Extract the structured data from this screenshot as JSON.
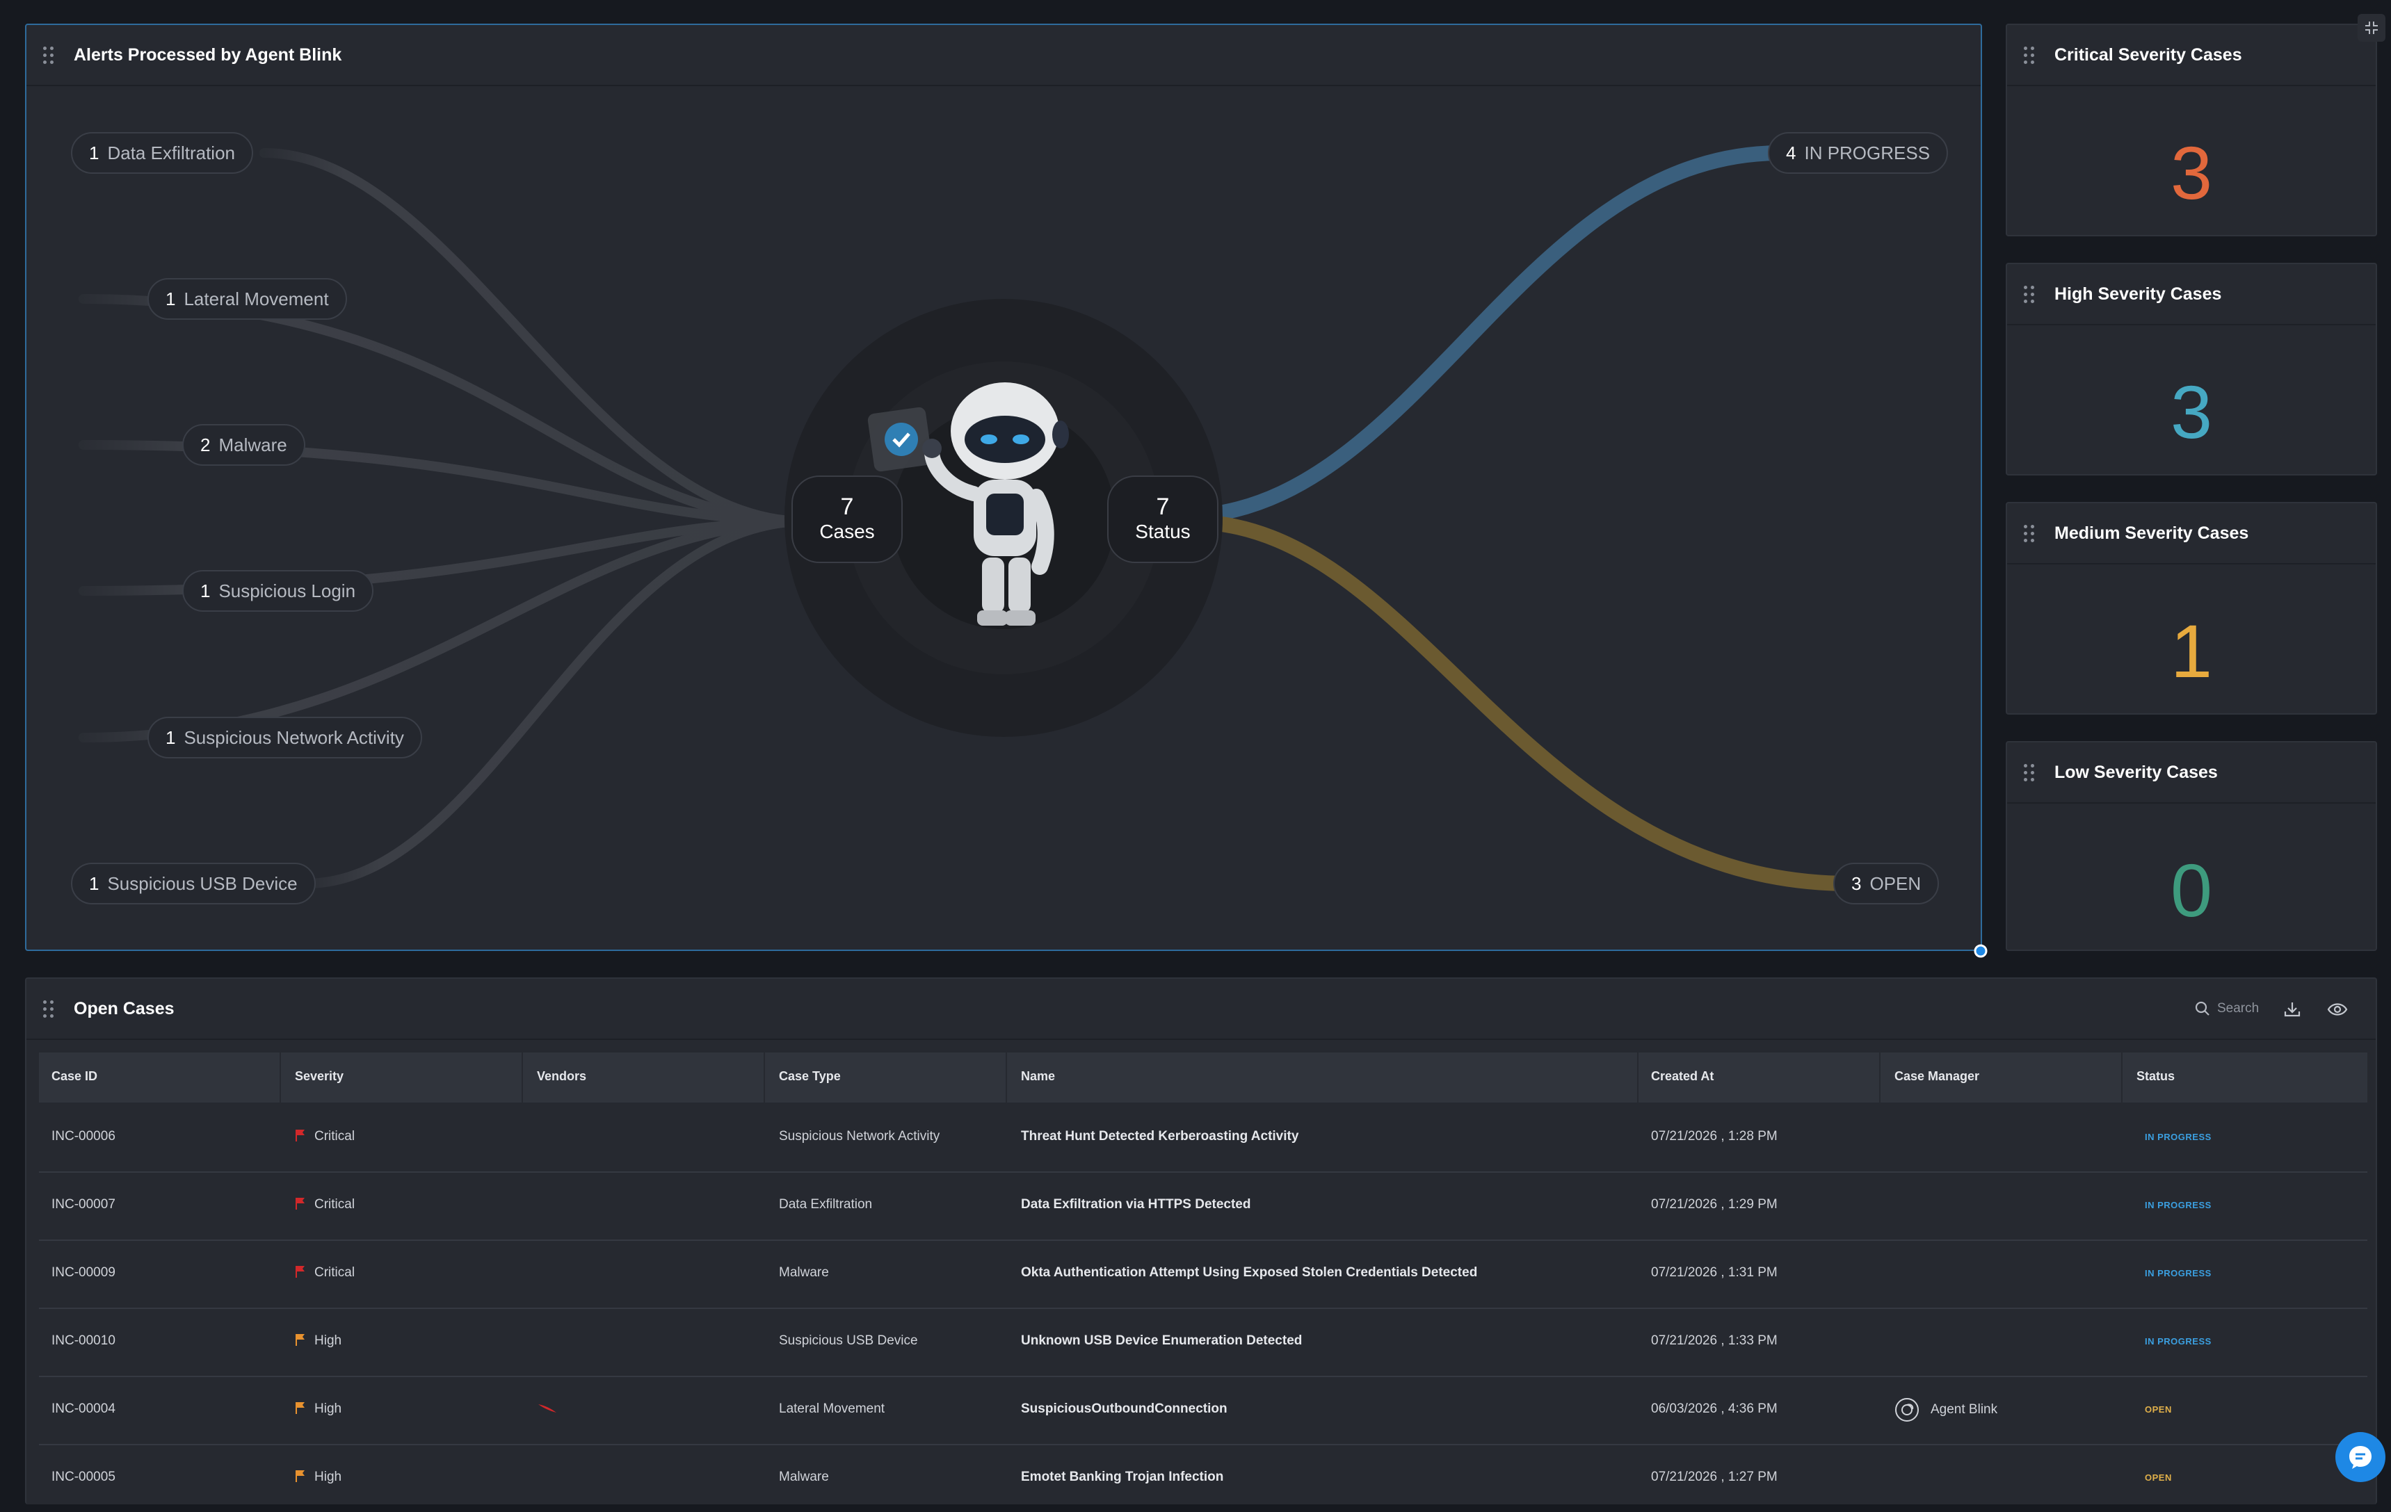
{
  "flow_panel": {
    "title": "Alerts Processed by Agent Blink",
    "case_types": [
      {
        "count": "1",
        "label": "Data Exfiltration"
      },
      {
        "count": "1",
        "label": "Lateral Movement"
      },
      {
        "count": "2",
        "label": "Malware"
      },
      {
        "count": "1",
        "label": "Suspicious Login"
      },
      {
        "count": "1",
        "label": "Suspicious Network Activity"
      },
      {
        "count": "1",
        "label": "Suspicious USB Device"
      }
    ],
    "cases_hub": {
      "count": "7",
      "label": "Cases"
    },
    "status_hub": {
      "count": "7",
      "label": "Status"
    },
    "statuses": [
      {
        "count": "4",
        "label": "IN PROGRESS",
        "color": "#3a5f7d"
      },
      {
        "count": "3",
        "label": "OPEN",
        "color": "#6b5a30"
      }
    ]
  },
  "severity_cards": [
    {
      "title": "Critical Severity Cases",
      "value": "3",
      "color": "#e2683c"
    },
    {
      "title": "High Severity Cases",
      "value": "3",
      "color": "#46a8c2"
    },
    {
      "title": "Medium Severity Cases",
      "value": "1",
      "color": "#e7aa3e"
    },
    {
      "title": "Low Severity Cases",
      "value": "0",
      "color": "#3e9b7e"
    }
  ],
  "open_cases": {
    "title": "Open Cases",
    "search_label": "Search",
    "columns": [
      "Case ID",
      "Severity",
      "Vendors",
      "Case Type",
      "Name",
      "Created At",
      "Case Manager",
      "Status"
    ],
    "rows": [
      {
        "id": "INC-00006",
        "severity": "Critical",
        "severity_color": "#d2282a",
        "vendor": "",
        "type": "Suspicious Network Activity",
        "name": "Threat Hunt Detected Kerberoasting Activity",
        "created": "07/21/2026 , 1:28 PM",
        "manager": "",
        "status": "IN PROGRESS"
      },
      {
        "id": "INC-00007",
        "severity": "Critical",
        "severity_color": "#d2282a",
        "vendor": "",
        "type": "Data Exfiltration",
        "name": "Data Exfiltration via HTTPS Detected",
        "created": "07/21/2026 , 1:29 PM",
        "manager": "",
        "status": "IN PROGRESS"
      },
      {
        "id": "INC-00009",
        "severity": "Critical",
        "severity_color": "#d2282a",
        "vendor": "",
        "type": "Malware",
        "name": "Okta Authentication Attempt Using Exposed Stolen Credentials Detected",
        "created": "07/21/2026 , 1:31 PM",
        "manager": "",
        "status": "IN PROGRESS"
      },
      {
        "id": "INC-00010",
        "severity": "High",
        "severity_color": "#e8922f",
        "vendor": "",
        "type": "Suspicious USB Device",
        "name": "Unknown USB Device Enumeration Detected",
        "created": "07/21/2026 , 1:33 PM",
        "manager": "",
        "status": "IN PROGRESS"
      },
      {
        "id": "INC-00004",
        "severity": "High",
        "severity_color": "#e8922f",
        "vendor": "falcon-icon",
        "type": "Lateral Movement",
        "name": "SuspiciousOutboundConnection",
        "created": "06/03/2026 , 4:36 PM",
        "manager": "Agent Blink",
        "status": "OPEN"
      },
      {
        "id": "INC-00005",
        "severity": "High",
        "severity_color": "#e8922f",
        "vendor": "",
        "type": "Malware",
        "name": "Emotet Banking Trojan Infection",
        "created": "07/21/2026 , 1:27 PM",
        "manager": "",
        "status": "OPEN"
      }
    ]
  }
}
